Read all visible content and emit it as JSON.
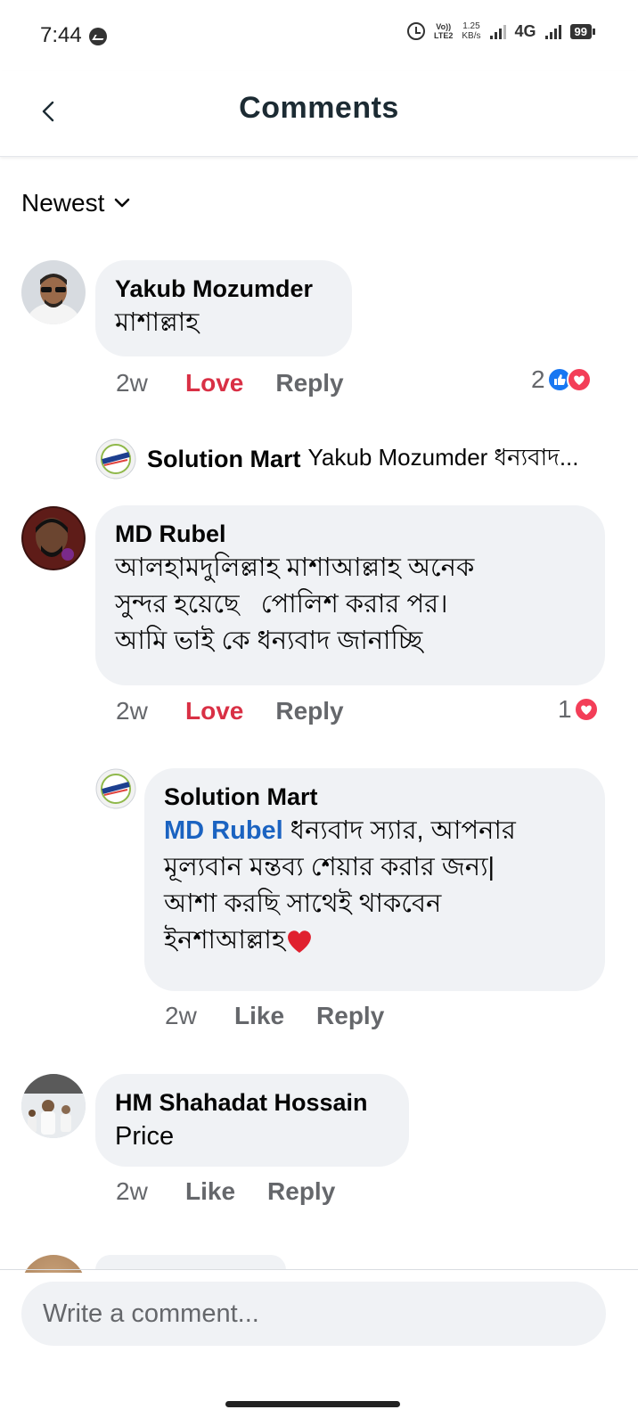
{
  "status_bar": {
    "time": "7:44",
    "volte_top": "Vo))",
    "volte_bottom": "LTE2",
    "speed_value": "1.25",
    "speed_unit": "KB/s",
    "network": "4G",
    "battery": "99"
  },
  "header": {
    "title": "Comments"
  },
  "sort": {
    "label": "Newest"
  },
  "comments": [
    {
      "author": "Yakub Mozumder",
      "text": "মাশাল্লাহ",
      "time": "2w",
      "react_action": "Love",
      "reply_action": "Reply",
      "reaction_count": "2",
      "reply_preview": {
        "author": "Solution Mart",
        "text": "Yakub Mozumder ধন্যবাদ..."
      }
    },
    {
      "author": "MD Rubel",
      "text_lines": [
        "আলহামদুলিল্লাহ মাশাআল্লাহ অনেক",
        "সুন্দর হয়েছে   পোলিশ করার পর।",
        "আমি ভাই কে ধন্যবাদ জানাচ্ছি"
      ],
      "time": "2w",
      "react_action": "Love",
      "reply_action": "Reply",
      "reaction_count": "1",
      "reply": {
        "author": "Solution Mart",
        "mention": "MD Rubel",
        "line1_rest": " ধন্যবাদ স্যার, আপনার",
        "line2": "মূল্যবান মন্তব্য শেয়ার করার জন্য|",
        "line3": "আশা করছি সাথেই থাকবেন",
        "line4": "ইনশাআল্লাহ",
        "time": "2w",
        "react_action": "Like",
        "reply_action": "Reply"
      }
    },
    {
      "author": "HM Shahadat Hossain",
      "text": "Price",
      "time": "2w",
      "react_action": "Like",
      "reply_action": "Reply"
    }
  ],
  "composer": {
    "placeholder": "Write a comment..."
  },
  "colors": {
    "love": "#d93045",
    "mention": "#1b63c1",
    "bubble": "#f0f2f5",
    "like_reaction": "#1877f2",
    "love_reaction": "#f33e58"
  }
}
